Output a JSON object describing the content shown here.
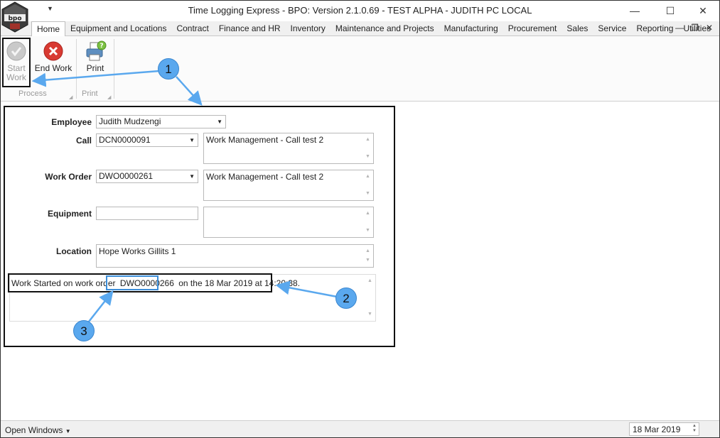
{
  "window": {
    "title": "Time Logging Express - BPO: Version 2.1.0.69 - TEST ALPHA - JUDITH PC LOCAL",
    "logo_text": "bpo"
  },
  "menu": {
    "tabs": [
      "Home",
      "Equipment and Locations",
      "Contract",
      "Finance and HR",
      "Inventory",
      "Maintenance and Projects",
      "Manufacturing",
      "Procurement",
      "Sales",
      "Service",
      "Reporting",
      "Utilities"
    ]
  },
  "ribbon": {
    "start_work_line1": "Start",
    "start_work_line2": "Work",
    "end_work": "End Work",
    "print": "Print",
    "group_process": "Process",
    "group_print": "Print"
  },
  "form": {
    "employee_label": "Employee",
    "employee_value": "Judith Mudzengi",
    "call_label": "Call",
    "call_value": "DCN0000091",
    "call_description": "Work Management - Call test 2",
    "work_order_label": "Work Order",
    "work_order_value": "DWO0000261",
    "work_order_description": "Work Management - Call test 2",
    "equipment_label": "Equipment",
    "equipment_value": "",
    "equipment_description": "",
    "location_label": "Location",
    "location_value": "Hope Works Gillits 1"
  },
  "status_message": {
    "prefix": "Work Started on work order",
    "work_order": "DWO0000266",
    "suffix": "on the 18 Mar 2019 at 14:20:38."
  },
  "callouts": [
    "1",
    "2",
    "3"
  ],
  "statusbar": {
    "open_windows": "Open Windows",
    "date": "18 Mar 2019"
  }
}
